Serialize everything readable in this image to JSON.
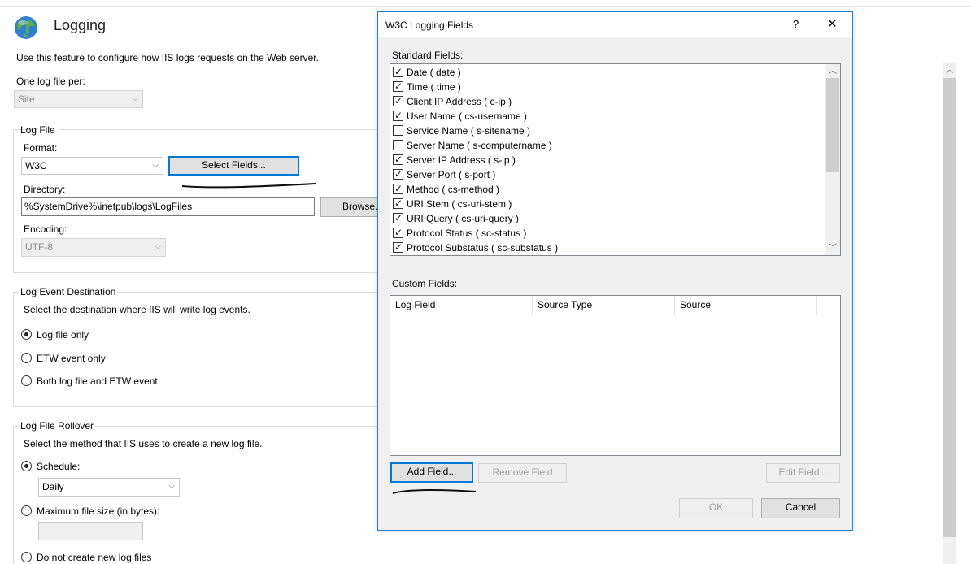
{
  "page": {
    "title": "Logging",
    "description": "Use this feature to configure how IIS logs requests on the Web server.",
    "one_log_file_per_label": "One log file per:",
    "one_log_file_per_value": "Site"
  },
  "log_file": {
    "group_label": "Log File",
    "format_label": "Format:",
    "format_value": "W3C",
    "select_fields_label": "Select Fields...",
    "directory_label": "Directory:",
    "directory_value": "%SystemDrive%\\inetpub\\logs\\LogFiles",
    "browse_label": "Browse...",
    "encoding_label": "Encoding:",
    "encoding_value": "UTF-8"
  },
  "log_event_destination": {
    "group_label": "Log Event Destination",
    "description": "Select the destination where IIS will write log events.",
    "options": [
      {
        "label": "Log file only",
        "checked": true
      },
      {
        "label": "ETW event only",
        "checked": false
      },
      {
        "label": "Both log file and ETW event",
        "checked": false
      }
    ]
  },
  "log_file_rollover": {
    "group_label": "Log File Rollover",
    "description": "Select the method that IIS uses to create a new log file.",
    "schedule_label": "Schedule:",
    "schedule_value": "Daily",
    "max_size_label": "Maximum file size (in bytes):",
    "no_new_files_label": "Do not create new log files"
  },
  "dialog": {
    "title": "W3C Logging Fields",
    "help_glyph": "?",
    "close_glyph": "✕",
    "standard_fields_label": "Standard Fields:",
    "standard_fields": [
      {
        "label": "Date ( date )",
        "checked": true
      },
      {
        "label": "Time ( time )",
        "checked": true
      },
      {
        "label": "Client IP Address ( c-ip )",
        "checked": true
      },
      {
        "label": "User Name ( cs-username )",
        "checked": true
      },
      {
        "label": "Service Name ( s-sitename )",
        "checked": false
      },
      {
        "label": "Server Name ( s-computername )",
        "checked": false
      },
      {
        "label": "Server IP Address ( s-ip )",
        "checked": true
      },
      {
        "label": "Server Port ( s-port )",
        "checked": true
      },
      {
        "label": "Method ( cs-method )",
        "checked": true
      },
      {
        "label": "URI Stem ( cs-uri-stem )",
        "checked": true
      },
      {
        "label": "URI Query ( cs-uri-query )",
        "checked": true
      },
      {
        "label": "Protocol Status ( sc-status )",
        "checked": true
      },
      {
        "label": "Protocol Substatus ( sc-substatus )",
        "checked": true
      }
    ],
    "custom_fields_label": "Custom Fields:",
    "custom_columns": [
      "Log Field",
      "Source Type",
      "Source"
    ],
    "add_field_label": "Add Field...",
    "remove_field_label": "Remove Field",
    "edit_field_label": "Edit Field...",
    "ok_label": "OK",
    "cancel_label": "Cancel"
  },
  "icons": {
    "globe": "globe-icon",
    "combo_arrow": "chevron-down-icon",
    "scroll_up": "chevron-up-icon",
    "scroll_down": "chevron-down-icon"
  },
  "colors": {
    "accent": "#0078d7",
    "dialog_border": "#1883d7",
    "dialog_background": "#f0f0f0"
  }
}
